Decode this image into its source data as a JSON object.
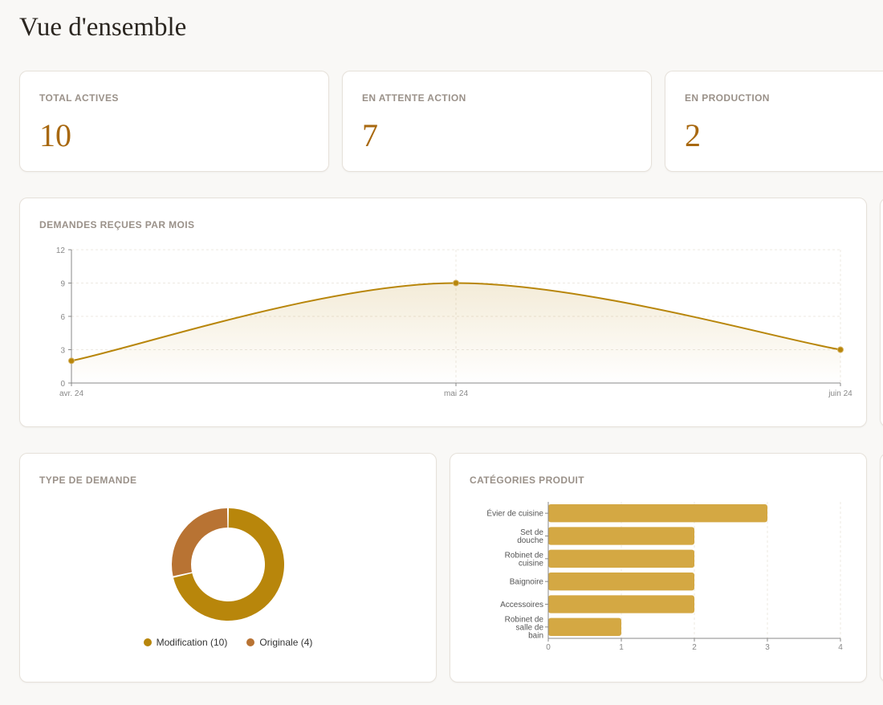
{
  "page_title": "Vue d'ensemble",
  "stats": [
    {
      "label": "TOTAL ACTIVES",
      "value": "10"
    },
    {
      "label": "EN ATTENTE ACTION",
      "value": "7"
    },
    {
      "label": "EN PRODUCTION",
      "value": "2"
    }
  ],
  "colors": {
    "accent": "#b8860b",
    "secondary": "#b87333",
    "bar": "#d4a843",
    "value": "#a8680f"
  },
  "chart_data": [
    {
      "type": "area",
      "title": "DEMANDES REÇUES PAR MOIS",
      "categories": [
        "avr. 24",
        "mai 24",
        "juin 24"
      ],
      "values": [
        2,
        9,
        3
      ],
      "ylim": [
        0,
        12
      ],
      "yticks": [
        0,
        3,
        6,
        9,
        12
      ],
      "grid": true
    },
    {
      "type": "pie",
      "title": "TYPE DE DEMANDE",
      "series": [
        {
          "name": "Modification",
          "value": 10,
          "legend": "Modification (10)",
          "color": "#b8860b"
        },
        {
          "name": "Originale",
          "value": 4,
          "legend": "Originale (4)",
          "color": "#b87333"
        }
      ],
      "legend_position": "bottom"
    },
    {
      "type": "bar",
      "orientation": "horizontal",
      "title": "CATÉGORIES PRODUIT",
      "categories": [
        [
          "Évier de cuisine"
        ],
        [
          "Set de",
          "douche"
        ],
        [
          "Robinet de",
          "cuisine"
        ],
        [
          "Baignoire"
        ],
        [
          "Accessoires"
        ],
        [
          "Robinet de",
          "salle de",
          "bain"
        ]
      ],
      "values": [
        3,
        2,
        2,
        2,
        2,
        1
      ],
      "xlim": [
        0,
        4
      ],
      "xticks": [
        0,
        1,
        2,
        3,
        4
      ],
      "grid": true
    }
  ]
}
